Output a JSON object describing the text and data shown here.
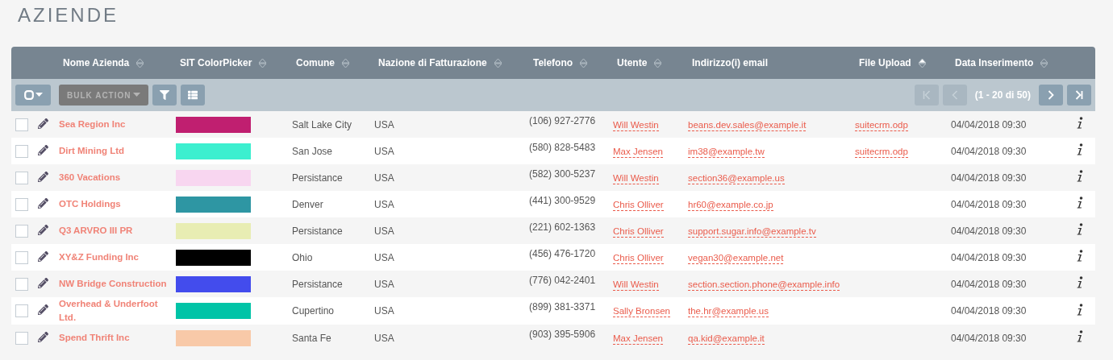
{
  "page_title": "AZIENDE",
  "columns": [
    {
      "label": "Nome Azienda",
      "sortable": true,
      "sorted": false
    },
    {
      "label": "SIT ColorPicker",
      "sortable": true,
      "sorted": false
    },
    {
      "label": "Comune",
      "sortable": true,
      "sorted": false
    },
    {
      "label": "Nazione di Fatturazione",
      "sortable": true,
      "sorted": false
    },
    {
      "label": "Telefono",
      "sortable": true,
      "sorted": false
    },
    {
      "label": "Utente",
      "sortable": true,
      "sorted": false
    },
    {
      "label": "Indirizzo(i) email",
      "sortable": false
    },
    {
      "label": "File Upload",
      "sortable": true,
      "sorted": true
    },
    {
      "label": "Data Inserimento",
      "sortable": true,
      "sorted": false
    }
  ],
  "toolbar": {
    "bulk_action": {
      "label": "BULK ACTION",
      "disabled": true
    },
    "pagination": {
      "summary": "(1 - 20 di 50)",
      "first_disabled": true,
      "prev_disabled": true,
      "next_disabled": false,
      "last_disabled": false
    }
  },
  "rows": [
    {
      "checked": false,
      "name": "Sea Region Inc",
      "color": "#c01f70",
      "city": "Salt Lake City",
      "country": "USA",
      "phone": "(106) 927-2776",
      "user": "Will Westin",
      "email": "beans.dev.sales@example.it",
      "file": "suitecrm.odp",
      "date": "04/04/2018 09:30"
    },
    {
      "checked": false,
      "name": "Dirt Mining Ltd",
      "color": "#3cefcf",
      "city": "San Jose",
      "country": "USA",
      "phone": "(580) 828-5483",
      "user": "Max Jensen",
      "email": "im38@example.tw",
      "file": "suitecrm.odp",
      "date": "04/04/2018 09:30"
    },
    {
      "checked": false,
      "name": "360 Vacations",
      "color": "#f8d6f0",
      "city": "Persistance",
      "country": "USA",
      "phone": "(582) 300-5237",
      "user": "Will Westin",
      "email": "section36@example.us",
      "date": "04/04/2018 09:30"
    },
    {
      "checked": false,
      "name": "OTC Holdings",
      "color": "#2e96a3",
      "city": "Denver",
      "country": "USA",
      "phone": "(441) 300-9529",
      "user": "Chris Olliver",
      "email": "hr60@example.co.jp",
      "date": "04/04/2018 09:30"
    },
    {
      "checked": false,
      "name": "Q3 ARVRO III PR",
      "color": "#e8edb3",
      "city": "Persistance",
      "country": "USA",
      "phone": "(221) 602-1363",
      "user": "Chris Olliver",
      "email": "support.sugar.info@example.tv",
      "date": "04/04/2018 09:30"
    },
    {
      "checked": false,
      "name": "XY&Z Funding Inc",
      "color": "#000000",
      "city": "Ohio",
      "country": "USA",
      "phone": "(456) 476-1720",
      "user": "Chris Olliver",
      "email": "vegan30@example.net",
      "date": "04/04/2018 09:30"
    },
    {
      "checked": false,
      "name": "NW Bridge Construction",
      "color": "#434ced",
      "city": "Persistance",
      "country": "USA",
      "phone": "(776) 042-2401",
      "user": "Will Westin",
      "email": "section.section.phone@example.info",
      "date": "04/04/2018 09:30"
    },
    {
      "checked": false,
      "name": "Overhead & Underfoot Ltd.",
      "color": "#00c4a7",
      "city": "Cupertino",
      "country": "USA",
      "phone": "(899) 381-3371",
      "user": "Sally Bronsen",
      "email": "the.hr@example.us",
      "date": "04/04/2018 09:30"
    },
    {
      "checked": false,
      "name": "Spend Thrift Inc",
      "color": "#f8c9a8",
      "city": "Santa Fe",
      "country": "USA",
      "phone": "(903) 395-5906",
      "user": "Max Jensen",
      "email": "qa.kid@example.it",
      "date": "04/04/2018 09:30"
    }
  ]
}
